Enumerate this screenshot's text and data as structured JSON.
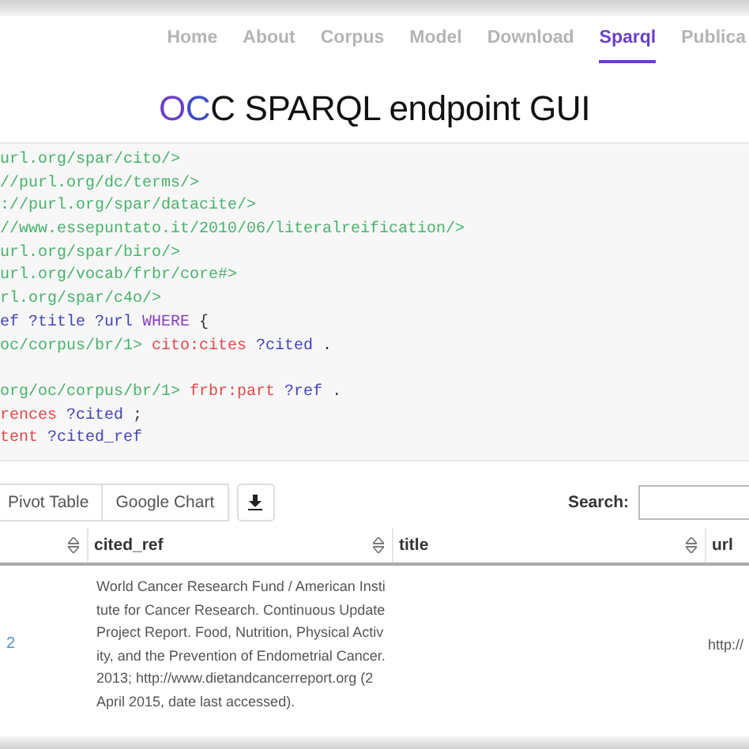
{
  "nav": {
    "items": [
      {
        "label": "Home",
        "selected": false
      },
      {
        "label": "About",
        "selected": false
      },
      {
        "label": "Corpus",
        "selected": false
      },
      {
        "label": "Model",
        "selected": false
      },
      {
        "label": "Download",
        "selected": false
      },
      {
        "label": "Sparql",
        "selected": true
      },
      {
        "label": "Publica",
        "selected": false
      }
    ]
  },
  "title": {
    "parts": [
      {
        "text": "O",
        "color": "#6a3fc8"
      },
      {
        "text": "C",
        "color": "#3f4fc4"
      },
      {
        "text": "C SPARQL endpoint GUI",
        "color": "#111111"
      }
    ]
  },
  "query": {
    "lines": [
      [
        {
          "kind": "iri",
          "text": "url.org/spar/cito/>"
        }
      ],
      [
        {
          "kind": "iri",
          "text": "//purl.org/dc/terms/>"
        }
      ],
      [
        {
          "kind": "iri",
          "text": "://purl.org/spar/datacite/>"
        }
      ],
      [
        {
          "kind": "iri",
          "text": "//www.essepuntato.it/2010/06/literalreification/>"
        }
      ],
      [
        {
          "kind": "iri",
          "text": "url.org/spar/biro/>"
        }
      ],
      [
        {
          "kind": "iri",
          "text": "url.org/vocab/frbr/core#>"
        }
      ],
      [
        {
          "kind": "iri",
          "text": "rl.org/spar/c4o/>"
        }
      ],
      [
        {
          "kind": "var",
          "text": "ef ?title ?url"
        },
        {
          "kind": "keyword",
          "text": "WHERE"
        },
        {
          "kind": "punct",
          "text": "{"
        }
      ],
      [
        {
          "kind": "iri",
          "text": "oc/corpus/br/1>"
        },
        {
          "kind": "predicate",
          "text": "cito:cites"
        },
        {
          "kind": "var",
          "text": "?cited"
        },
        {
          "kind": "punct",
          "text": "."
        }
      ],
      {
        "spaced": true,
        "tokens": [
          {
            "kind": "iri",
            "text": "org/oc/corpus/br/1>"
          },
          {
            "kind": "predicate",
            "text": "frbr:part"
          },
          {
            "kind": "var",
            "text": "?ref"
          },
          {
            "kind": "punct",
            "text": "."
          }
        ]
      },
      [
        {
          "kind": "predicate",
          "text": "rences"
        },
        {
          "kind": "var",
          "text": "?cited"
        },
        {
          "kind": "punct",
          "text": ";"
        }
      ],
      [
        {
          "kind": "predicate",
          "text": "tent"
        },
        {
          "kind": "var",
          "text": "?cited_ref"
        }
      ]
    ]
  },
  "toolbar": {
    "buttons": [
      "Pivot Table",
      "Google Chart"
    ],
    "search_label": "Search:"
  },
  "table": {
    "columns": [
      "",
      "cited_ref",
      "title",
      "url"
    ],
    "rows": [
      [
        "2",
        "World Cancer Research Fund / American Institute for Cancer Research. Continuous Update Project Report. Food, Nutrition, Physical Activity, and the Prevention of Endometrial Cancer. 2013; http://www.dietandcancerreport.org (2 April 2015, date last accessed).",
        "",
        "http://"
      ]
    ]
  }
}
